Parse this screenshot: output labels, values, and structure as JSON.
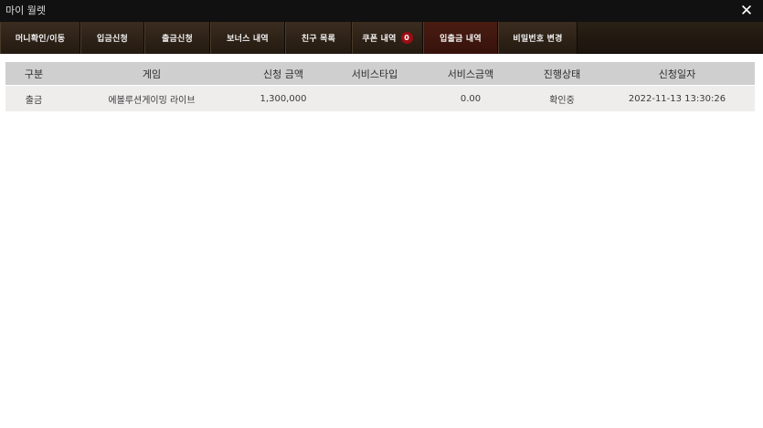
{
  "window": {
    "title": "마이 월렛",
    "close_icon": "close-icon"
  },
  "tabs": [
    {
      "label": "머니확인/이동"
    },
    {
      "label": "입금신청"
    },
    {
      "label": "출금신청"
    },
    {
      "label": "보너스 내역"
    },
    {
      "label": "친구 목록"
    },
    {
      "label": "쿠폰 내역",
      "badge": "0"
    },
    {
      "label": "입출금 내역",
      "active": true
    },
    {
      "label": "비밀번호 변경"
    }
  ],
  "table": {
    "headers": [
      "구분",
      "게임",
      "신청 금액",
      "서비스타입",
      "서비스금액",
      "진행상태",
      "신청일자"
    ],
    "rows": [
      [
        "출금",
        "에볼루션게이밍 라이브",
        "1,300,000",
        "",
        "0.00",
        "확인중",
        "2022-11-13 13:30:26"
      ]
    ]
  },
  "colors": {
    "titlebar": "#111111",
    "tab_bg": "#2e2218",
    "tab_active": "#4a1c12",
    "badge": "#9b0d14",
    "header_row": "#cfcfcf",
    "data_row": "#efecec"
  }
}
